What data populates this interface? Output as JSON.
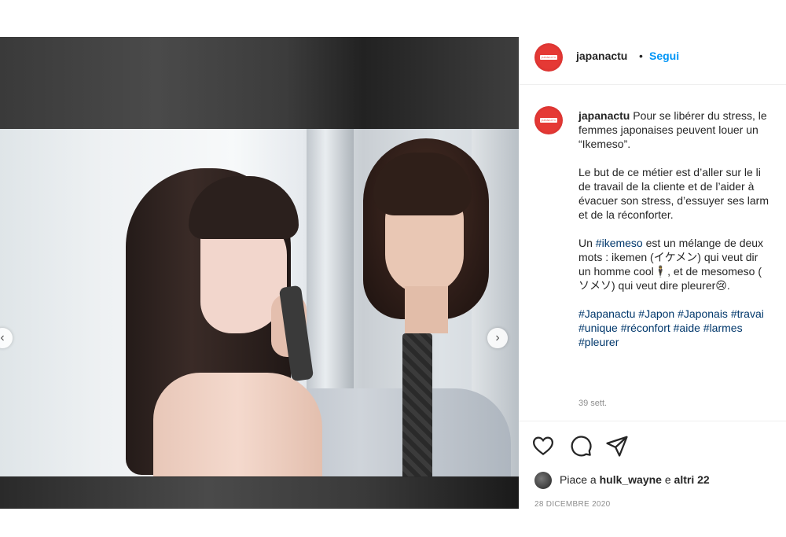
{
  "post": {
    "username": "japanactu",
    "separator": "•",
    "follow_label": "Segui",
    "caption_user": "japanactu",
    "caption_paragraphs": [
      [
        "Pour se libérer du stress, le",
        "femmes japonaises peuvent louer un",
        "“Ikemeso”."
      ],
      [
        "Le but de ce métier est d’aller sur le li",
        "de travail de la cliente et de l’aider à",
        "évacuer son stress, d’essuyer ses larm",
        "et de la réconforter."
      ]
    ],
    "para3": {
      "line1_prefix": "Un ",
      "line1_tag": "#ikemeso",
      "line1_suffix": " est un mélange de deux",
      "line2": "mots : ikemen (イケメン) qui veut dir",
      "line3": "un homme cool🕴, et de mesomeso (",
      "line4": "ソメソ) qui veut dire pleurer😢."
    },
    "hashtags_lines": [
      "#Japanactu #Japon #Japonais #travai",
      "#unique #réconfort #aide #larmes",
      "#pleurer"
    ],
    "time_ago": "39 sett.",
    "likes": {
      "prefix": "Piace a ",
      "user": "hulk_wayne",
      "middle": " e ",
      "others": "altri 22"
    },
    "date": "28 DICEMBRE 2020"
  },
  "avatar_logo_text": "JAPANACTU",
  "icons": {
    "like": "heart-outline-icon",
    "comment": "comment-bubble-icon",
    "share": "paper-plane-icon",
    "prev": "chevron-left-icon",
    "next": "chevron-right-icon"
  },
  "nav": {
    "prev_glyph": "‹",
    "next_glyph": "›"
  },
  "colors": {
    "link": "#0095f6",
    "hashtag": "#00376b",
    "avatar_red": "#e53935",
    "muted": "#8e8e8e"
  }
}
